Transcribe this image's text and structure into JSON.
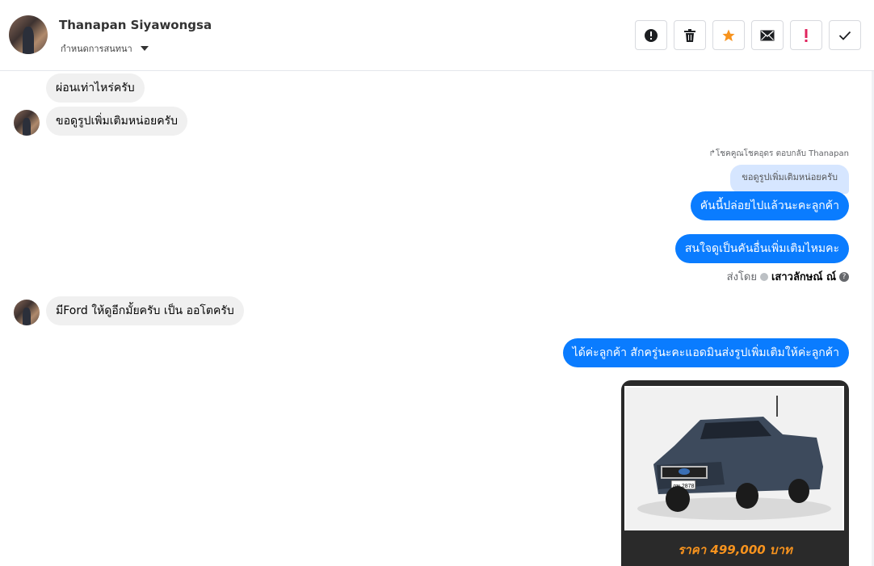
{
  "header": {
    "contact_name": "Thanapan Siyawongsa",
    "settings_label": "กำหนดการสนทนา",
    "actions": [
      {
        "name": "report",
        "icon": "alert-circle-icon"
      },
      {
        "name": "delete",
        "icon": "trash-icon"
      },
      {
        "name": "star",
        "icon": "star-icon",
        "color": "#f7931e"
      },
      {
        "name": "mark-unread",
        "icon": "envelope-icon"
      },
      {
        "name": "important",
        "icon": "exclamation-icon",
        "color": "#e0245e"
      },
      {
        "name": "done",
        "icon": "check-icon"
      }
    ]
  },
  "messages": {
    "m1": "ผ่อนเท่าไหร่ครับ",
    "m2": "ขอดูรูปเพิ่มเติมหน่อยครับ",
    "reply_note": "↱โชคคูณโชคอุดร ตอบกลับ Thanapan",
    "quoted": "ขอดูรูปเพิ่มเติมหน่อยครับ",
    "m3": "คันนี้ปล่อยไปแล้วนะคะลูกค้า",
    "m4": "สนใจดูเป็นคันอื่นเพิ่มเติมไหมคะ",
    "sent_by_label": "ส่งโดย",
    "sent_by_name": "เสาวลักษณ์ ณ์",
    "sent_by_help": "?",
    "m5": "มีFord ให้ดูอีกมั้ยครับ เป็น ออโตครับ",
    "m6": "ได้ค่ะลูกค้า สักครู่นะคะแอดมินส่งรูปเพิ่มเติมให้ค่ะลูกค้า",
    "photo_price": "ราคา 499,000 บาท",
    "plate_text": "ฎพ 2878"
  },
  "colors": {
    "outgoing": "#0a7cff",
    "incoming": "#f0f0f0",
    "price": "#f7931e"
  }
}
